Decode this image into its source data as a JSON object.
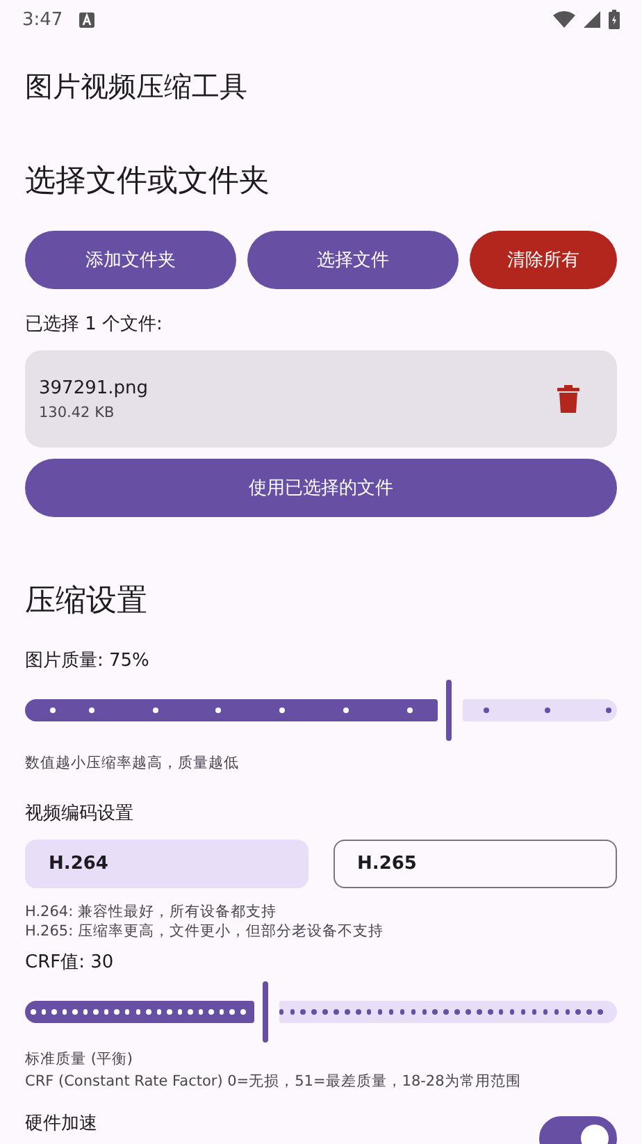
{
  "status_bar": {
    "time": "3:47"
  },
  "app_title": "图片视频压缩工具",
  "file_section": {
    "heading": "选择文件或文件夹",
    "buttons": [
      {
        "label": "添加文件夹",
        "kind": "primary"
      },
      {
        "label": "选择文件",
        "kind": "primary"
      },
      {
        "label": "清除所有",
        "kind": "danger"
      }
    ],
    "selected_count": "已选择 1 个文件:",
    "files": [
      {
        "name": "397291.png",
        "size": "130.42 KB"
      }
    ],
    "use_button": "使用已选择的文件"
  },
  "compression": {
    "heading": "压缩设置",
    "image_quality": {
      "label": "图片质量: 75%",
      "level": 0.72,
      "hint": "数值越小压缩率越高，质量越低"
    },
    "codec": {
      "label": "视频编码设置",
      "options": [
        {
          "label": "H.264",
          "selected": true
        },
        {
          "label": "H.265",
          "selected": false
        }
      ],
      "notes": [
        "H.264: 兼容性最好，所有设备都支持",
        "H.265: 压缩率更高，文件更小，但部分老设备不支持"
      ]
    },
    "crf": {
      "label": "CRF值: 30",
      "level": 0.41,
      "quality": "标准质量 (平衡)",
      "note": "CRF (Constant Rate Factor) 0=无损，51=最差质量，18-28为常用范围"
    },
    "hardware": {
      "label": "硬件加速",
      "on": true
    }
  }
}
